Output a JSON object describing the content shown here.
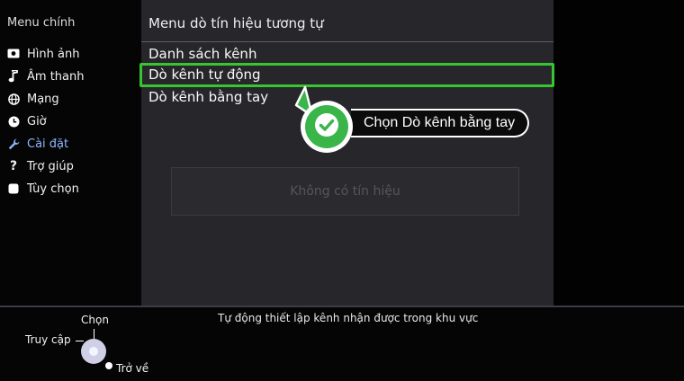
{
  "sidebar": {
    "title": "Menu chính",
    "items": [
      {
        "label": "Hình ảnh",
        "icon": "picture-icon"
      },
      {
        "label": "Âm thanh",
        "icon": "music-note-icon"
      },
      {
        "label": "Mạng",
        "icon": "globe-icon"
      },
      {
        "label": "Giờ",
        "icon": "clock-icon"
      },
      {
        "label": "Cài đặt",
        "icon": "wrench-icon",
        "active": true
      },
      {
        "label": "Trợ giúp",
        "icon": "question-icon"
      },
      {
        "label": "Tùy chọn",
        "icon": "options-icon"
      }
    ]
  },
  "panel": {
    "title": "Menu dò tín hiệu tương tự",
    "items": [
      {
        "label": "Danh sách kênh"
      },
      {
        "label": "Dò kênh tự động",
        "selected": true
      },
      {
        "label": "Dò kênh bằng tay"
      }
    ],
    "no_signal": "Không có tín hiệu"
  },
  "callout": {
    "text": "Chọn Dò kênh bằng tay",
    "icon": "checkmark-icon"
  },
  "bottom": {
    "hint": "Tự động thiết lập kênh nhận được trong khu vực",
    "select_label": "Chọn",
    "access_label": "Truy cập",
    "back_label": "Trở về"
  },
  "colors": {
    "highlight": "#37c62f",
    "active_menu": "#8fb6ff",
    "check_green": "#39b54a"
  }
}
